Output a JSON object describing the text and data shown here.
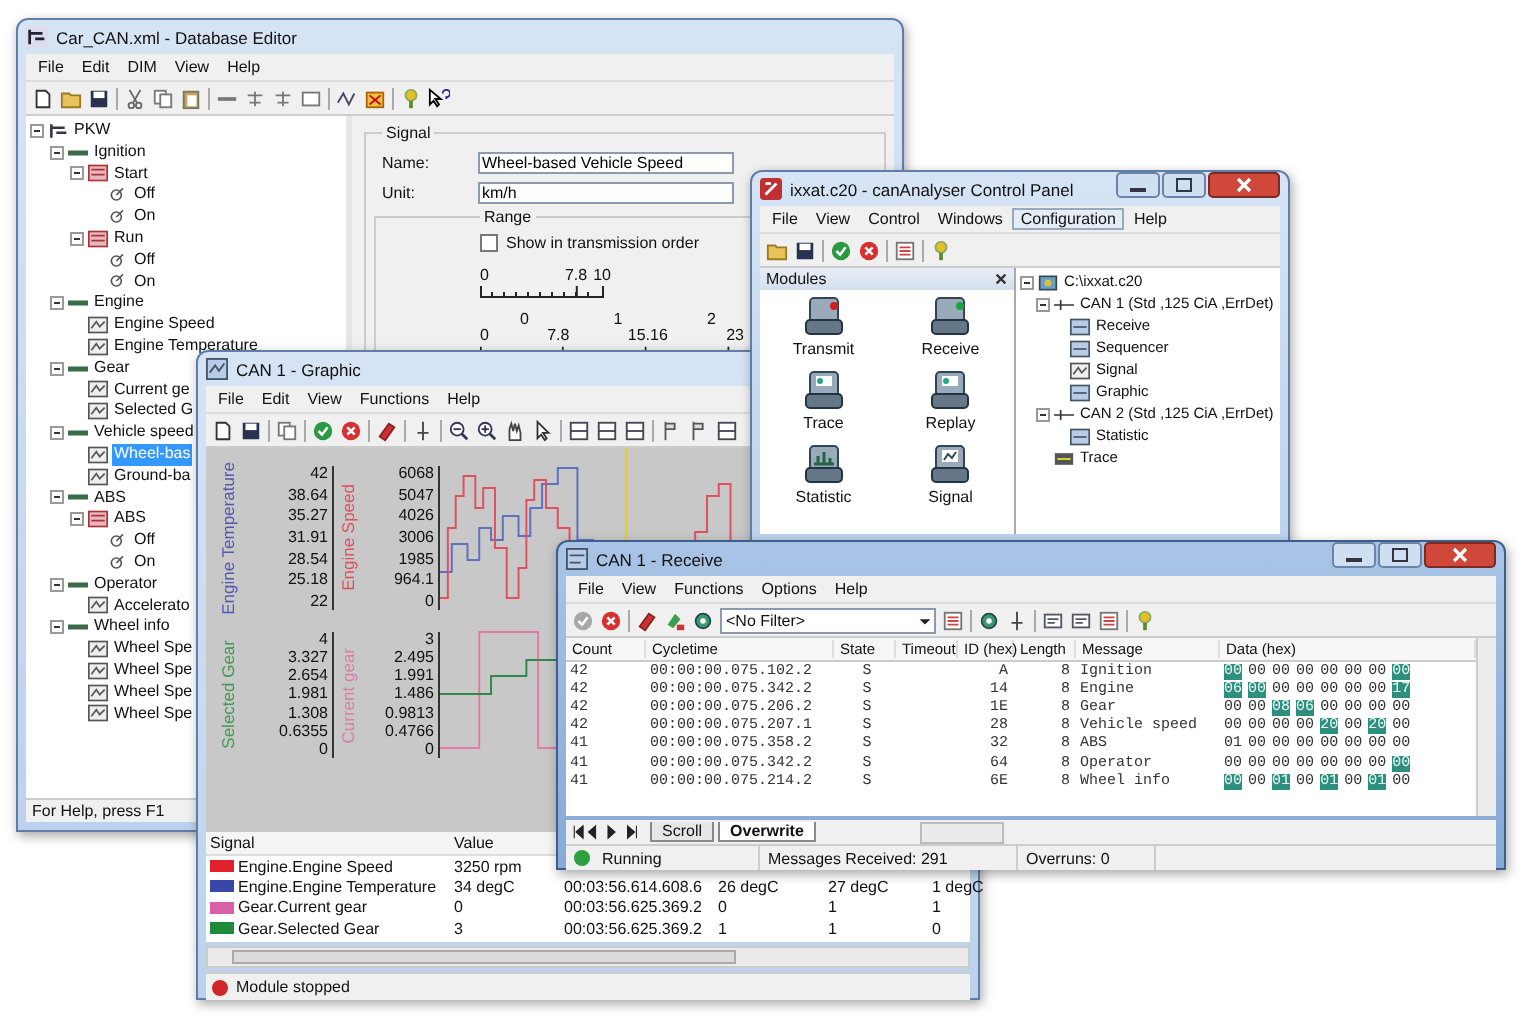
{
  "database_editor": {
    "title": "Car_CAN.xml - Database Editor",
    "menu": [
      "File",
      "Edit",
      "DIM",
      "View",
      "Help"
    ],
    "tree": {
      "label": "PKW",
      "kind": "root",
      "expanded": true,
      "selected": false,
      "children": [
        {
          "label": "Ignition",
          "kind": "message",
          "expanded": true,
          "selected": false,
          "children": [
            {
              "label": "Start",
              "kind": "group",
              "expanded": true,
              "selected": false,
              "children": [
                {
                  "label": "Off",
                  "kind": "value",
                  "selected": false
                },
                {
                  "label": "On",
                  "kind": "value",
                  "selected": false
                }
              ]
            },
            {
              "label": "Run",
              "kind": "group",
              "expanded": true,
              "selected": false,
              "children": [
                {
                  "label": "Off",
                  "kind": "value",
                  "selected": false
                },
                {
                  "label": "On",
                  "kind": "value",
                  "selected": false
                }
              ]
            }
          ]
        },
        {
          "label": "Engine",
          "kind": "message",
          "expanded": true,
          "selected": false,
          "children": [
            {
              "label": "Engine Speed",
              "kind": "signal",
              "selected": false
            },
            {
              "label": "Engine Temperature",
              "kind": "signal",
              "selected": false
            }
          ]
        },
        {
          "label": "Gear",
          "kind": "message",
          "expanded": true,
          "selected": false,
          "children": [
            {
              "label": "Current ge",
              "kind": "signal",
              "selected": false
            },
            {
              "label": "Selected G",
              "kind": "signal",
              "selected": false
            }
          ]
        },
        {
          "label": "Vehicle speed",
          "kind": "message",
          "expanded": true,
          "selected": false,
          "children": [
            {
              "label": "Wheel-bas",
              "kind": "signal",
              "selected": true
            },
            {
              "label": "Ground-ba",
              "kind": "signal",
              "selected": false
            }
          ]
        },
        {
          "label": "ABS",
          "kind": "message",
          "expanded": true,
          "selected": false,
          "children": [
            {
              "label": "ABS",
              "kind": "group",
              "expanded": true,
              "selected": false,
              "children": [
                {
                  "label": "Off",
                  "kind": "value",
                  "selected": false
                },
                {
                  "label": "On",
                  "kind": "value",
                  "selected": false
                }
              ]
            }
          ]
        },
        {
          "label": "Operator",
          "kind": "message",
          "expanded": true,
          "selected": false,
          "children": [
            {
              "label": "Accelerato",
              "kind": "signal",
              "selected": false
            }
          ]
        },
        {
          "label": "Wheel info",
          "kind": "message",
          "expanded": true,
          "selected": false,
          "children": [
            {
              "label": "Wheel Spe",
              "kind": "signal",
              "selected": false
            },
            {
              "label": "Wheel Spe",
              "kind": "signal",
              "selected": false
            },
            {
              "label": "Wheel Spe",
              "kind": "signal",
              "selected": false
            },
            {
              "label": "Wheel Spe",
              "kind": "signal",
              "selected": false
            }
          ]
        }
      ]
    },
    "signal_group": {
      "legend": "Signal",
      "name_label": "Name:",
      "name_value": "Wheel-based Vehicle Speed",
      "unit_label": "Unit:",
      "unit_value": "km/h",
      "range_legend": "Range",
      "order_option": {
        "label": "Show in transmission order",
        "checked": false
      },
      "scale_1": [
        "0",
        "7.8",
        "10"
      ],
      "scale_2_upper": [
        "0",
        "1",
        "2"
      ],
      "scale_2_lower": [
        "0",
        "7.8",
        "15.16",
        "23"
      ]
    },
    "status": "For Help, press F1"
  },
  "graphic_window": {
    "title": "CAN 1 - Graphic",
    "menu": [
      "File",
      "Edit",
      "View",
      "Functions",
      "Help"
    ],
    "upper_axes": [
      {
        "title": "Engine Temperature",
        "color": "#5058b0",
        "ticks": [
          "42",
          "38.64",
          "35.27",
          "31.91",
          "28.54",
          "25.18",
          "22"
        ]
      },
      {
        "title": "Engine Speed",
        "color": "#e04f5c",
        "ticks": [
          "6068",
          "5047",
          "4026",
          "3006",
          "1985",
          "964.1",
          "0"
        ]
      }
    ],
    "lower_axes": [
      {
        "title": "Selected Gear",
        "color": "#3f9a52",
        "ticks": [
          "4",
          "3.327",
          "2.654",
          "1.981",
          "1.308",
          "0.6355",
          "0"
        ]
      },
      {
        "title": "Current gear",
        "color": "#e07aa8",
        "ticks": [
          "3",
          "2.495",
          "1.991",
          "1.486",
          "0.9813",
          "0.4766",
          "0"
        ]
      }
    ],
    "table_columns": [
      "Signal",
      "Value"
    ],
    "table_rows": [
      {
        "color": "#e0202a",
        "cells": [
          "Engine.Engine Speed",
          "3250 rpm"
        ]
      },
      {
        "color": "#3848a8",
        "cells": [
          "Engine.Engine Temperature",
          "34 degC",
          "00:03:56.614.608.6",
          "26 degC",
          "27 degC",
          "1 degC"
        ]
      },
      {
        "color": "#d860a8",
        "cells": [
          "Gear.Current gear",
          "0",
          "00:03:56.625.369.2",
          "0",
          "1",
          "1"
        ]
      },
      {
        "color": "#1f8a3a",
        "cells": [
          "Gear.Selected Gear",
          "3",
          "00:03:56.625.369.2",
          "1",
          "1",
          "0"
        ]
      }
    ],
    "status": {
      "running": false,
      "text": "Module stopped"
    }
  },
  "control_panel": {
    "title": "ixxat.c20 - canAnalyser Control Panel",
    "menu": [
      {
        "label": "File",
        "selected": false
      },
      {
        "label": "View",
        "selected": false
      },
      {
        "label": "Control",
        "selected": false
      },
      {
        "label": "Windows",
        "selected": false
      },
      {
        "label": "Configuration",
        "selected": true
      },
      {
        "label": "Help",
        "selected": false
      }
    ],
    "modules_title": "Modules",
    "modules": [
      {
        "label": "Transmit",
        "kind": "transmit"
      },
      {
        "label": "Receive",
        "kind": "receive"
      },
      {
        "label": "Trace",
        "kind": "trace"
      },
      {
        "label": "Replay",
        "kind": "replay"
      },
      {
        "label": "Statistic",
        "kind": "statistic"
      },
      {
        "label": "Signal",
        "kind": "signal"
      }
    ],
    "tree": {
      "label": "C:\\ixxat.c20",
      "kind": "file",
      "expanded": true,
      "selected": false,
      "children": [
        {
          "label": "CAN 1 (Std ,125 CiA ,ErrDet)",
          "kind": "channel",
          "expanded": true,
          "selected": false,
          "children": [
            {
              "label": "Receive",
              "kind": "receive",
              "selected": false
            },
            {
              "label": "Sequencer",
              "kind": "sequencer",
              "selected": false
            },
            {
              "label": "Signal",
              "kind": "signal",
              "selected": false
            },
            {
              "label": "Graphic",
              "kind": "graphic",
              "selected": false
            }
          ]
        },
        {
          "label": "CAN 2 (Std ,125 CiA ,ErrDet)",
          "kind": "channel",
          "expanded": true,
          "selected": false,
          "children": [
            {
              "label": "Statistic",
              "kind": "statistic",
              "selected": false
            }
          ]
        },
        {
          "label": "Trace",
          "kind": "trace",
          "selected": false
        }
      ]
    }
  },
  "receive_window": {
    "title": "CAN 1 - Receive",
    "menu": [
      "File",
      "View",
      "Functions",
      "Options",
      "Help"
    ],
    "filter": "<No Filter>",
    "columns": [
      "Count",
      "Cycletime",
      "State",
      "Timeout",
      "ID (hex)",
      "Length",
      "Message",
      "Data (hex)"
    ],
    "rows": [
      {
        "count": "42",
        "cycletime": "00:00:00.075.102.2",
        "state": "S",
        "id": "A",
        "length": "8",
        "message": "Ignition",
        "data": [
          {
            "byte": "00",
            "changed": true
          },
          {
            "byte": "00",
            "changed": false
          },
          {
            "byte": "00",
            "changed": false
          },
          {
            "byte": "00",
            "changed": false
          },
          {
            "byte": "00",
            "changed": false
          },
          {
            "byte": "00",
            "changed": false
          },
          {
            "byte": "00",
            "changed": false
          },
          {
            "byte": "00",
            "changed": true
          }
        ]
      },
      {
        "count": "42",
        "cycletime": "00:00:00.075.342.2",
        "state": "S",
        "id": "14",
        "length": "8",
        "message": "Engine",
        "data": [
          {
            "byte": "06",
            "changed": true
          },
          {
            "byte": "00",
            "changed": true
          },
          {
            "byte": "00",
            "changed": false
          },
          {
            "byte": "00",
            "changed": false
          },
          {
            "byte": "00",
            "changed": false
          },
          {
            "byte": "00",
            "changed": false
          },
          {
            "byte": "00",
            "changed": false
          },
          {
            "byte": "17",
            "changed": true
          }
        ]
      },
      {
        "count": "42",
        "cycletime": "00:00:00.075.206.2",
        "state": "S",
        "id": "1E",
        "length": "8",
        "message": "Gear",
        "data": [
          {
            "byte": "00",
            "changed": false
          },
          {
            "byte": "00",
            "changed": false
          },
          {
            "byte": "08",
            "changed": true
          },
          {
            "byte": "06",
            "changed": true
          },
          {
            "byte": "00",
            "changed": false
          },
          {
            "byte": "00",
            "changed": false
          },
          {
            "byte": "00",
            "changed": false
          },
          {
            "byte": "00",
            "changed": false
          }
        ]
      },
      {
        "count": "42",
        "cycletime": "00:00:00.075.207.1",
        "state": "S",
        "id": "28",
        "length": "8",
        "message": "Vehicle speed",
        "data": [
          {
            "byte": "00",
            "changed": false
          },
          {
            "byte": "00",
            "changed": false
          },
          {
            "byte": "00",
            "changed": false
          },
          {
            "byte": "00",
            "changed": false
          },
          {
            "byte": "20",
            "changed": true
          },
          {
            "byte": "00",
            "changed": false
          },
          {
            "byte": "20",
            "changed": true
          },
          {
            "byte": "00",
            "changed": false
          }
        ]
      },
      {
        "count": "41",
        "cycletime": "00:00:00.075.358.2",
        "state": "S",
        "id": "32",
        "length": "8",
        "message": "ABS",
        "data": [
          {
            "byte": "01",
            "changed": false
          },
          {
            "byte": "00",
            "changed": false
          },
          {
            "byte": "00",
            "changed": false
          },
          {
            "byte": "00",
            "changed": false
          },
          {
            "byte": "00",
            "changed": false
          },
          {
            "byte": "00",
            "changed": false
          },
          {
            "byte": "00",
            "changed": false
          },
          {
            "byte": "00",
            "changed": false
          }
        ]
      },
      {
        "count": "41",
        "cycletime": "00:00:00.075.342.2",
        "state": "S",
        "id": "64",
        "length": "8",
        "message": "Operator",
        "data": [
          {
            "byte": "00",
            "changed": false
          },
          {
            "byte": "00",
            "changed": false
          },
          {
            "byte": "00",
            "changed": false
          },
          {
            "byte": "00",
            "changed": false
          },
          {
            "byte": "00",
            "changed": false
          },
          {
            "byte": "00",
            "changed": false
          },
          {
            "byte": "00",
            "changed": false
          },
          {
            "byte": "00",
            "changed": true
          }
        ]
      },
      {
        "count": "41",
        "cycletime": "00:00:00.075.214.2",
        "state": "S",
        "id": "6E",
        "length": "8",
        "message": "Wheel info",
        "data": [
          {
            "byte": "00",
            "changed": true
          },
          {
            "byte": "00",
            "changed": false
          },
          {
            "byte": "01",
            "changed": true
          },
          {
            "byte": "00",
            "changed": false
          },
          {
            "byte": "01",
            "changed": true
          },
          {
            "byte": "00",
            "changed": false
          },
          {
            "byte": "01",
            "changed": true
          },
          {
            "byte": "00",
            "changed": false
          }
        ]
      }
    ],
    "tabs": [
      {
        "label": "Scroll",
        "selected": false
      },
      {
        "label": "Overwrite",
        "selected": true
      }
    ],
    "status": {
      "running": true,
      "text": "Running",
      "messages": "Messages Received: 291",
      "overruns": "Overruns: 0"
    }
  }
}
